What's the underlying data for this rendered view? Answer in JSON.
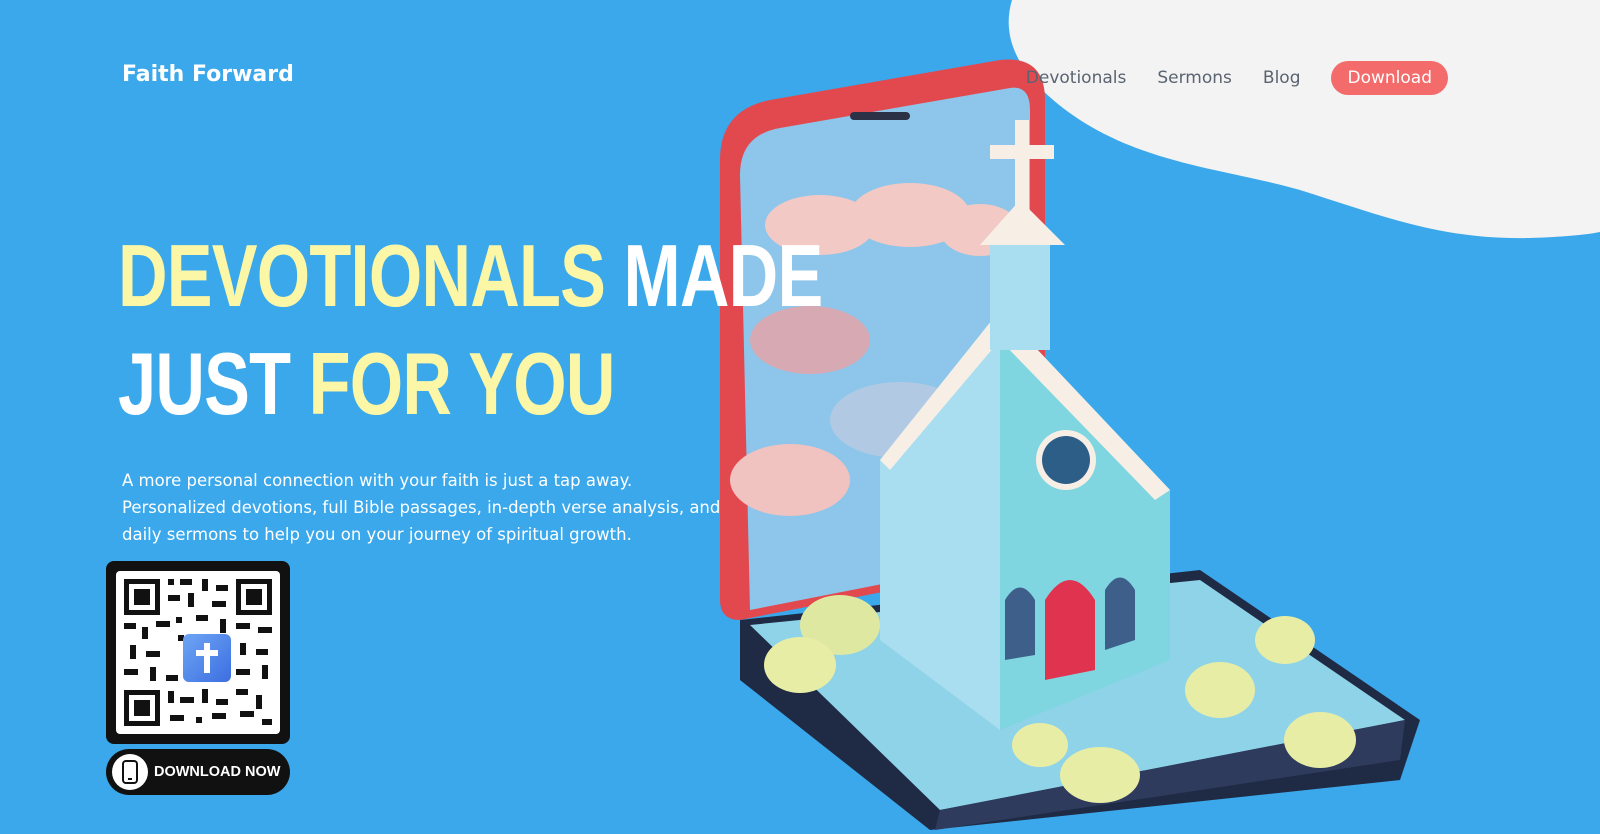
{
  "header": {
    "logo": "Faith Forward",
    "nav": [
      {
        "label": "Devotionals"
      },
      {
        "label": "Sermons"
      },
      {
        "label": "Blog"
      }
    ],
    "download_label": "Download"
  },
  "hero": {
    "headline_part1": "DEVOTIONALS",
    "headline_part2": "MADE",
    "headline_part3": "JUST",
    "headline_part4": "FOR YOU",
    "description_line1": "A more personal connection with your faith is just a tap away.",
    "description_line2": "Personalized devotions, full Bible passages, in-depth verse analysis, and",
    "description_line3": "daily sermons to help you on your journey of spiritual growth.",
    "download_now_label": "DOWNLOAD NOW"
  },
  "colors": {
    "background": "#3aa8eb",
    "accent_yellow": "#fbf7a7",
    "download_button": "#f36b6b",
    "nav_text": "#5a6470"
  },
  "icons": [
    "qr-code-icon",
    "cross-icon",
    "phone-icon"
  ]
}
